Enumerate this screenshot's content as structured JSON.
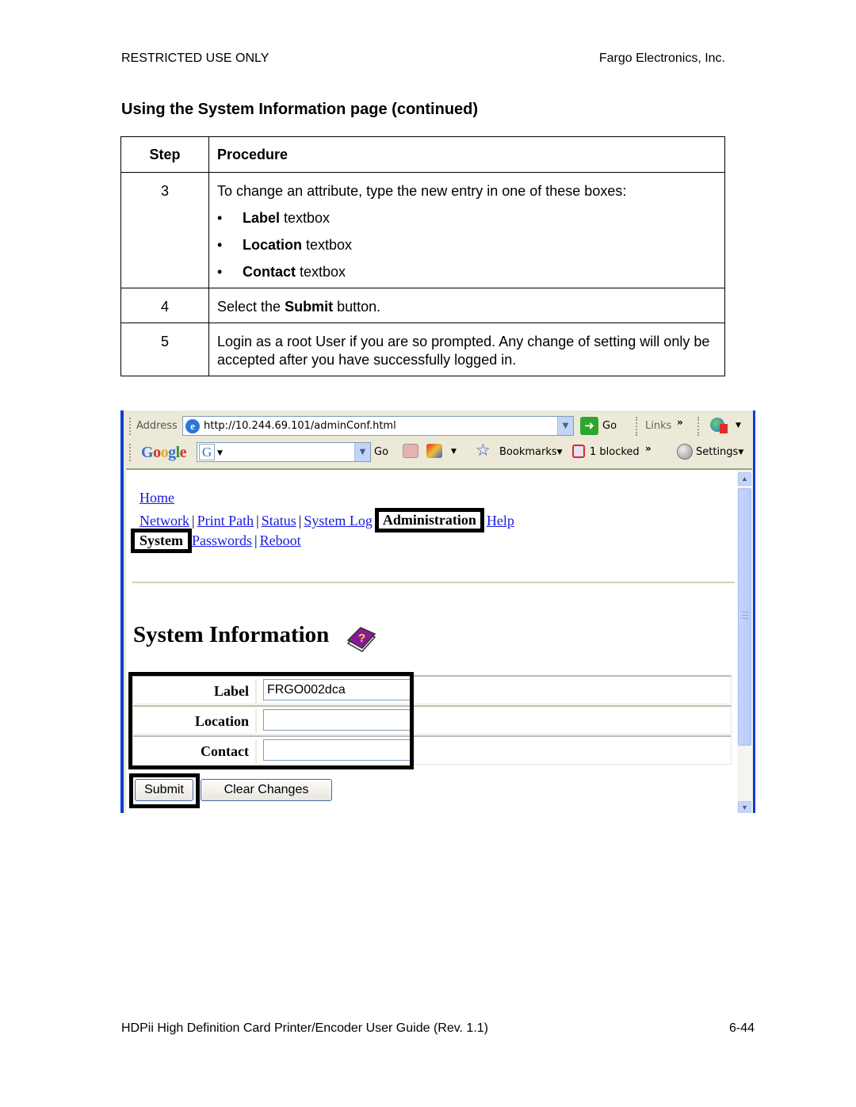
{
  "page_header": {
    "left": "RESTRICTED USE ONLY",
    "right": "Fargo Electronics, Inc."
  },
  "section_title": "Using the System Information page (continued)",
  "procedure_table": {
    "headers": [
      "Step",
      "Procedure"
    ],
    "rows": [
      {
        "step": "3",
        "text": "To change an attribute, type the new entry in one of these boxes:",
        "bullets": [
          {
            "bold": "Label",
            "rest": " textbox"
          },
          {
            "bold": "Location",
            "rest": " textbox"
          },
          {
            "bold": "Contact",
            "rest": " textbox"
          }
        ]
      },
      {
        "step": "4",
        "pre": "Select the ",
        "bold": "Submit",
        "post": " button."
      },
      {
        "step": "5",
        "text": "Login as a root User if you are so prompted. Any change of setting will only be accepted after you have successfully logged in."
      }
    ]
  },
  "browser": {
    "address_label": "Address",
    "url": "http://10.244.69.101/adminConf.html",
    "go_label": "Go",
    "links_label": "Links",
    "google_toolbar": {
      "logo": "Google",
      "go_label": "Go",
      "bookmarks_label": "Bookmarks",
      "blocked_label": "1 blocked",
      "settings_label": "Settings"
    },
    "page": {
      "nav_home": "Home",
      "nav_primary": [
        "Network",
        "Print Path",
        "Status",
        "System Log"
      ],
      "nav_active": "Administration",
      "nav_help": "Help",
      "subnav_active": "System",
      "subnav": [
        "Passwords",
        "Reboot"
      ],
      "title": "System Information",
      "form": [
        {
          "label": "Label",
          "value": "FRGO002dca"
        },
        {
          "label": "Location",
          "value": ""
        },
        {
          "label": "Contact",
          "value": ""
        }
      ],
      "submit_label": "Submit",
      "clear_label": "Clear Changes"
    }
  },
  "page_footer": {
    "left": "HDPii High Definition Card Printer/Encoder User Guide (Rev. 1.1)",
    "right": "6-44"
  }
}
